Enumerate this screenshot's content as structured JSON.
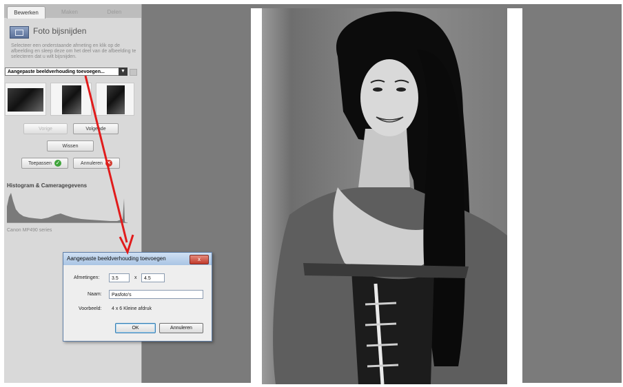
{
  "sidebar": {
    "tabs": [
      "Bewerken",
      "Maken",
      "Delen"
    ],
    "crop_title": "Foto bijsnijden",
    "description": "Selecteer een onderstaande afmeting en klik op de afbeelding en sleep deze om het deel van de afbeelding te selecteren dat u wilt bijsnijden.",
    "preset_select": "Aangepaste beeldverhouding toevoegen...",
    "buttons": {
      "previous": "Vorige",
      "next": "Volgende",
      "clear": "Wissen",
      "apply": "Toepassen",
      "cancel": "Annuleren"
    },
    "histogram_title": "Histogram & Cameragegevens",
    "camera": "Canon MP490 series"
  },
  "dialog": {
    "title": "Aangepaste beeldverhouding toevoegen",
    "close": "x",
    "dimensions_label": "Afmetingen:",
    "width": "3.5",
    "times": "x",
    "height": "4.5",
    "name_label": "Naam:",
    "name": "Pasfoto's",
    "example_label": "Voorbeeld:",
    "example": "4 x 6 Kleine afdruk",
    "ok": "OK",
    "cancel": "Annuleren"
  },
  "colors": {
    "workspace": "#7b7b7b",
    "sidebar": "#d9d9d9",
    "arrow": "#e11b1b",
    "apply_ok": "#3fa43a",
    "cancel_x": "#d23b2f"
  }
}
